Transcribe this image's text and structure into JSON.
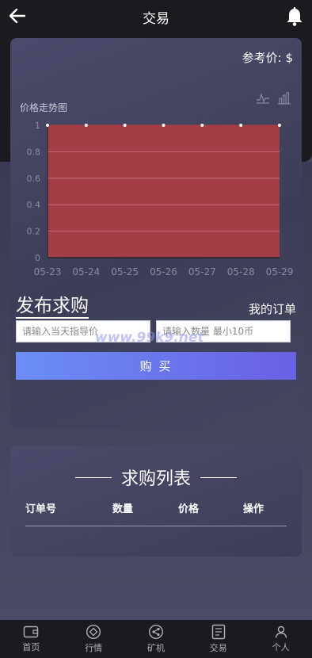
{
  "header": {
    "title": "交易"
  },
  "chart_card": {
    "ref_price_label": "参考价: $",
    "chart_title": "价格走势图"
  },
  "chart_data": {
    "type": "area",
    "x": [
      "05-23",
      "05-24",
      "05-25",
      "05-26",
      "05-27",
      "05-28",
      "05-29"
    ],
    "series": [
      {
        "values": [
          1,
          1,
          1,
          1,
          1,
          1,
          1
        ]
      }
    ],
    "yticks": [
      "0",
      "0.2",
      "0.4",
      "0.6",
      "0.8",
      "1"
    ],
    "ylim": [
      0,
      1
    ],
    "fill_color": "#a33e44",
    "grid": true
  },
  "publish": {
    "title": "发布求购",
    "my_orders": "我的订单",
    "price_placeholder": "请输入当天指导价",
    "qty_placeholder": "请输入数量 最小10币",
    "buy_label": "购 买",
    "watermark": "www.99k9.net"
  },
  "list": {
    "title": "求购列表",
    "columns": [
      "订单号",
      "数量",
      "价格",
      "操作"
    ]
  },
  "tabbar": {
    "items": [
      {
        "label": "首页",
        "icon": "wallet-icon"
      },
      {
        "label": "行情",
        "icon": "market-icon"
      },
      {
        "label": "矿机",
        "icon": "miner-icon"
      },
      {
        "label": "交易",
        "icon": "trade-icon"
      },
      {
        "label": "个人",
        "icon": "profile-icon"
      }
    ]
  },
  "colors": {
    "accent_start": "#6b8ef5",
    "accent_end": "#6a60e3",
    "chart_fill": "#a33e44"
  }
}
